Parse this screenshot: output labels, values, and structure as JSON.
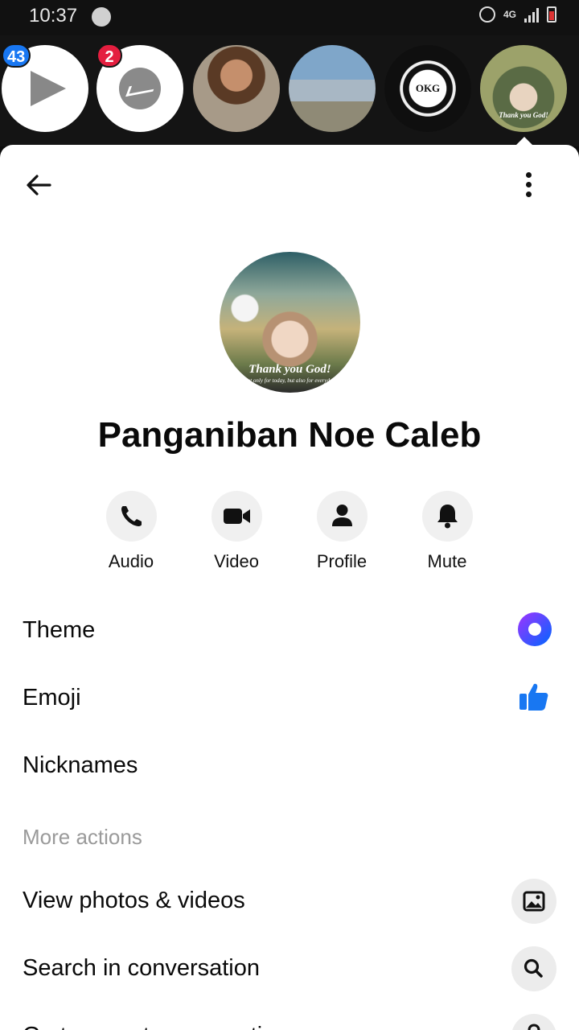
{
  "status_bar": {
    "time": "10:37",
    "network": "4G"
  },
  "stories": {
    "badges": [
      "43",
      "2"
    ],
    "bubble_labels": [
      "OKG",
      "Thank you God!"
    ]
  },
  "profile": {
    "avatar_caption": "Thank you God!",
    "avatar_subcaption": "Not only for today, but also for everyday.",
    "name": "Panganiban Noe Caleb"
  },
  "actions": [
    {
      "label": "Audio",
      "icon": "phone-icon"
    },
    {
      "label": "Video",
      "icon": "video-camera-icon"
    },
    {
      "label": "Profile",
      "icon": "person-icon"
    },
    {
      "label": "Mute",
      "icon": "bell-icon"
    }
  ],
  "settings": {
    "theme": "Theme",
    "emoji": "Emoji",
    "nicknames": "Nicknames"
  },
  "more_actions": {
    "title": "More actions",
    "items": [
      {
        "label": "View photos & videos",
        "icon": "image-icon"
      },
      {
        "label": "Search in conversation",
        "icon": "search-icon"
      },
      {
        "label": "Go to secret conversation",
        "icon": "lock-icon"
      }
    ]
  },
  "colors": {
    "accent_blue": "#1877f2",
    "badge_red": "#e41e3f",
    "theme_gradient_start": "#a033ff",
    "theme_gradient_end": "#0066ff"
  }
}
